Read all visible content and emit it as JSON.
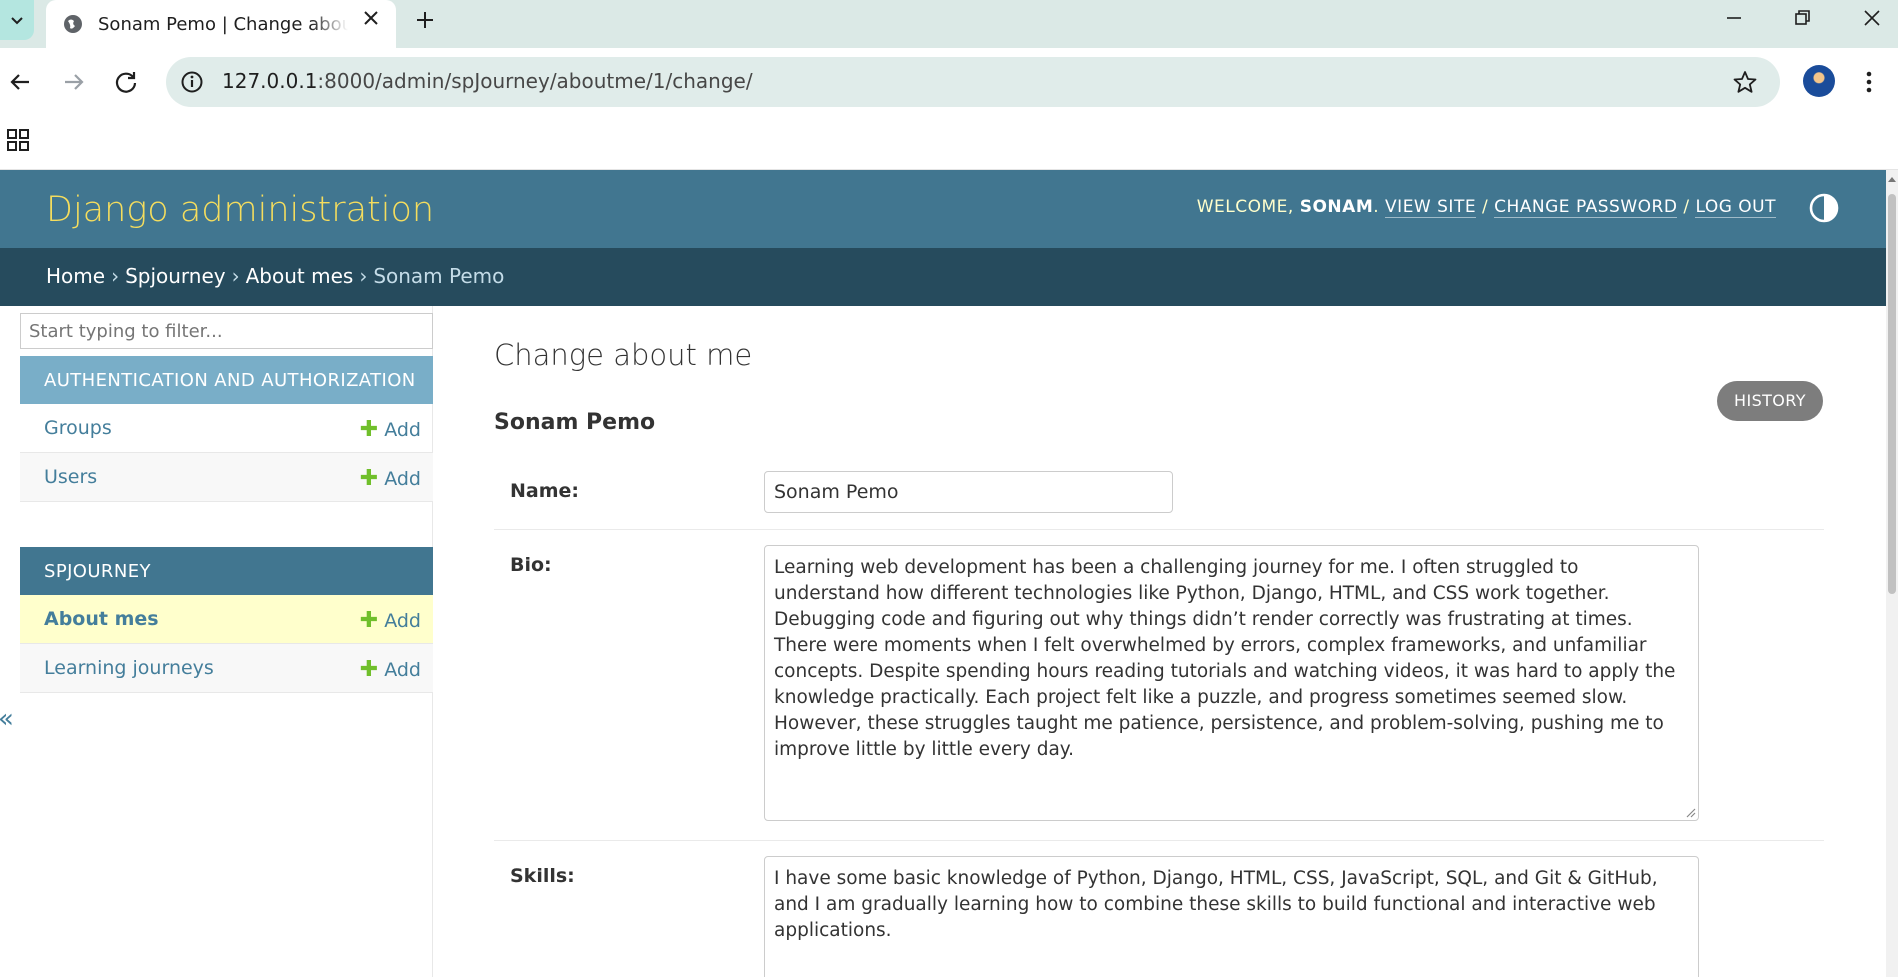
{
  "browser": {
    "tab_title": "Sonam Pemo | Change about me | Django site admin",
    "url_host": "127.0.0.1",
    "url_rest": ":8000/admin/spJourney/aboutme/1/change/"
  },
  "header": {
    "branding": "Django administration",
    "welcome": "Welcome,",
    "username": "Sonam",
    "view_site": "View site",
    "change_password": "Change password",
    "log_out": "Log out"
  },
  "breadcrumbs": {
    "home": "Home",
    "app": "Spjourney",
    "model": "About mes",
    "current": "Sonam Pemo"
  },
  "sidebar": {
    "filter_placeholder": "Start typing to filter...",
    "apps": [
      {
        "caption": "Authentication and Authorization",
        "models": [
          {
            "name": "Groups",
            "add": "Add"
          },
          {
            "name": "Users",
            "add": "Add"
          }
        ]
      },
      {
        "caption": "Spjourney",
        "models": [
          {
            "name": "About mes",
            "add": "Add"
          },
          {
            "name": "Learning journeys",
            "add": "Add"
          }
        ]
      }
    ],
    "collapse": "«"
  },
  "main": {
    "heading": "Change about me",
    "history_button": "History",
    "object_title": "Sonam Pemo",
    "fields": {
      "name_label": "Name:",
      "name_value": "Sonam Pemo",
      "bio_label": "Bio:",
      "bio_value": "Learning web development has been a challenging journey for me. I often struggled to understand how different technologies like Python, Django, HTML, and CSS work together. Debugging code and figuring out why things didn’t render correctly was frustrating at times. There were moments when I felt overwhelmed by errors, complex frameworks, and unfamiliar concepts. Despite spending hours reading tutorials and watching videos, it was hard to apply the knowledge practically. Each project felt like a puzzle, and progress sometimes seemed slow. However, these struggles taught me patience, persistence, and problem-solving, pushing me to improve little by little every day.",
      "skills_label": "Skills:",
      "skills_value": "I have some basic knowledge of Python, Django, HTML, CSS, JavaScript, SQL, and Git & GitHub, and I am gradually learning how to combine these skills to build functional and interactive web applications."
    }
  },
  "colors": {
    "header_bg": "#417690",
    "branding": "#f5dd5d",
    "breadcrumbs_bg": "#264b5d",
    "caption_bg": "#79aec8",
    "link": "#447e9b",
    "add_plus": "#70bf2b",
    "current_row": "#ffffcc"
  }
}
